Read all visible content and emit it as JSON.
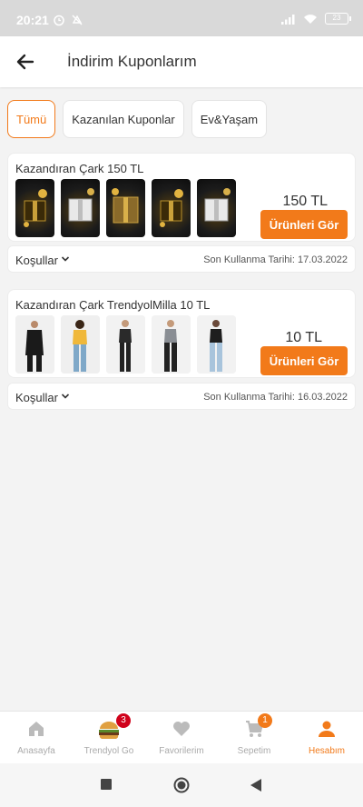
{
  "status": {
    "time": "20:21",
    "battery": "23"
  },
  "header": {
    "title": "İndirim Kuponlarım"
  },
  "tabs": [
    {
      "label": "Tümü",
      "active": true
    },
    {
      "label": "Kazanılan Kuponlar",
      "active": false
    },
    {
      "label": "Ev&Yaşam",
      "active": false
    }
  ],
  "coupons": [
    {
      "title": "Kazandıran Çark 150 TL",
      "amount": "150 TL",
      "button": "Ürünleri Gör",
      "conditions": "Koşullar",
      "expiry": "Son Kullanma Tarihi: 17.03.2022"
    },
    {
      "title": "Kazandıran Çark TrendyolMilla 10 TL",
      "amount": "10 TL",
      "button": "Ürünleri Gör",
      "conditions": "Koşullar",
      "expiry": "Son Kullanma Tarihi: 16.03.2022"
    }
  ],
  "nav": [
    {
      "label": "Anasayfa",
      "icon": "home-icon"
    },
    {
      "label": "Trendyol Go",
      "icon": "burger-icon",
      "badge": "3"
    },
    {
      "label": "Favorilerim",
      "icon": "heart-icon"
    },
    {
      "label": "Sepetim",
      "icon": "cart-icon",
      "badge": "1"
    },
    {
      "label": "Hesabım",
      "icon": "person-icon",
      "active": true
    }
  ],
  "colors": {
    "accent": "#f27a1a",
    "badge_red": "#d0021b",
    "background": "#f3f3f3"
  }
}
